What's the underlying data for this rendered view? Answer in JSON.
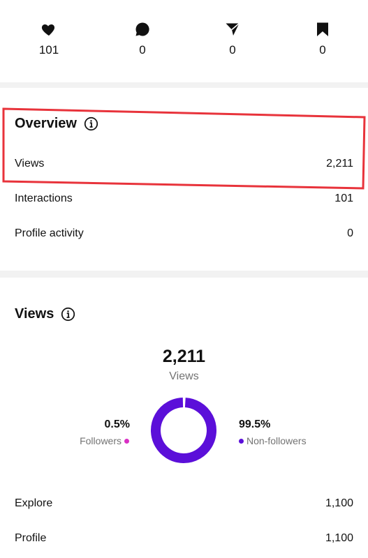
{
  "stats": [
    {
      "icon": "heart-icon",
      "value": "101"
    },
    {
      "icon": "comment-icon",
      "value": "0"
    },
    {
      "icon": "share-icon",
      "value": "0"
    },
    {
      "icon": "bookmark-icon",
      "value": "0"
    }
  ],
  "overview": {
    "title": "Overview",
    "rows": [
      {
        "label": "Views",
        "value": "2,211"
      },
      {
        "label": "Interactions",
        "value": "101"
      },
      {
        "label": "Profile activity",
        "value": "0"
      }
    ]
  },
  "views": {
    "title": "Views",
    "total": "2,211",
    "total_label": "Views",
    "followers": {
      "percent": "0.5%",
      "label": "Followers",
      "color": "#d92fc4"
    },
    "non_followers": {
      "percent": "99.5%",
      "label": "Non-followers",
      "color": "#5b0fd9"
    },
    "rows": [
      {
        "label": "Explore",
        "value": "1,100"
      },
      {
        "label": "Profile",
        "value": "1,100"
      }
    ]
  },
  "colors": {
    "highlight": "#e8333b",
    "donut": "#5b0fd9",
    "accent_pink": "#d92fc4"
  },
  "chart_data": {
    "type": "pie",
    "categories": [
      "Followers",
      "Non-followers"
    ],
    "values": [
      0.5,
      99.5
    ]
  }
}
